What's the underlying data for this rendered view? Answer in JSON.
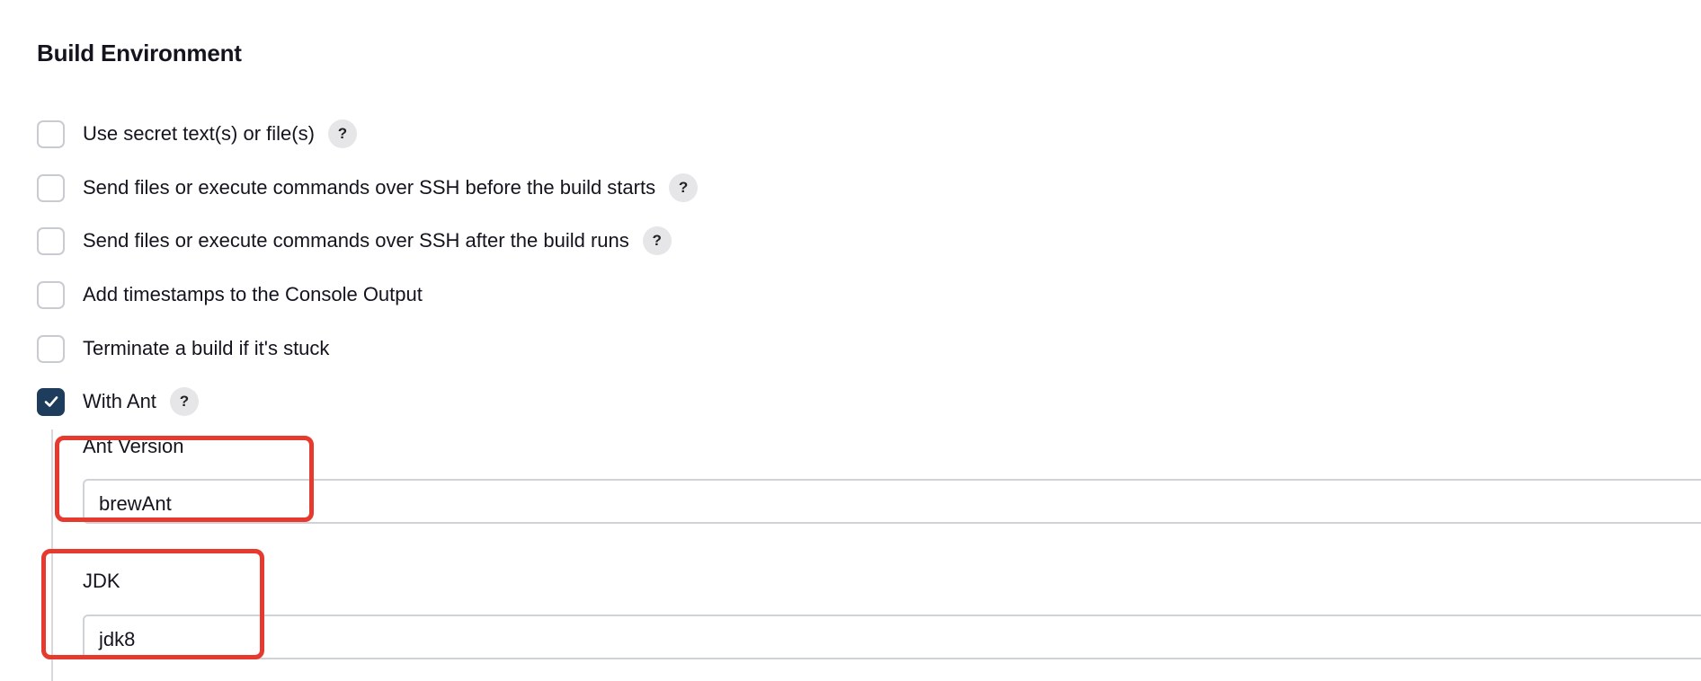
{
  "section": {
    "title": "Build Environment"
  },
  "options": [
    {
      "label": "Use secret text(s) or file(s)",
      "checked": false,
      "help": "?"
    },
    {
      "label": "Send files or execute commands over SSH before the build starts",
      "checked": false,
      "help": "?"
    },
    {
      "label": "Send files or execute commands over SSH after the build runs",
      "checked": false,
      "help": "?"
    },
    {
      "label": "Add timestamps to the Console Output",
      "checked": false
    },
    {
      "label": "Terminate a build if it's stuck",
      "checked": false
    },
    {
      "label": "With Ant",
      "checked": true,
      "help": "?"
    }
  ],
  "ant": {
    "version_label": "Ant Version",
    "version_value": "brewAnt",
    "jdk_label": "JDK",
    "jdk_value": "jdk8"
  },
  "colors": {
    "checked_fill": "#1e3d5c",
    "highlight": "#e63a2e"
  }
}
